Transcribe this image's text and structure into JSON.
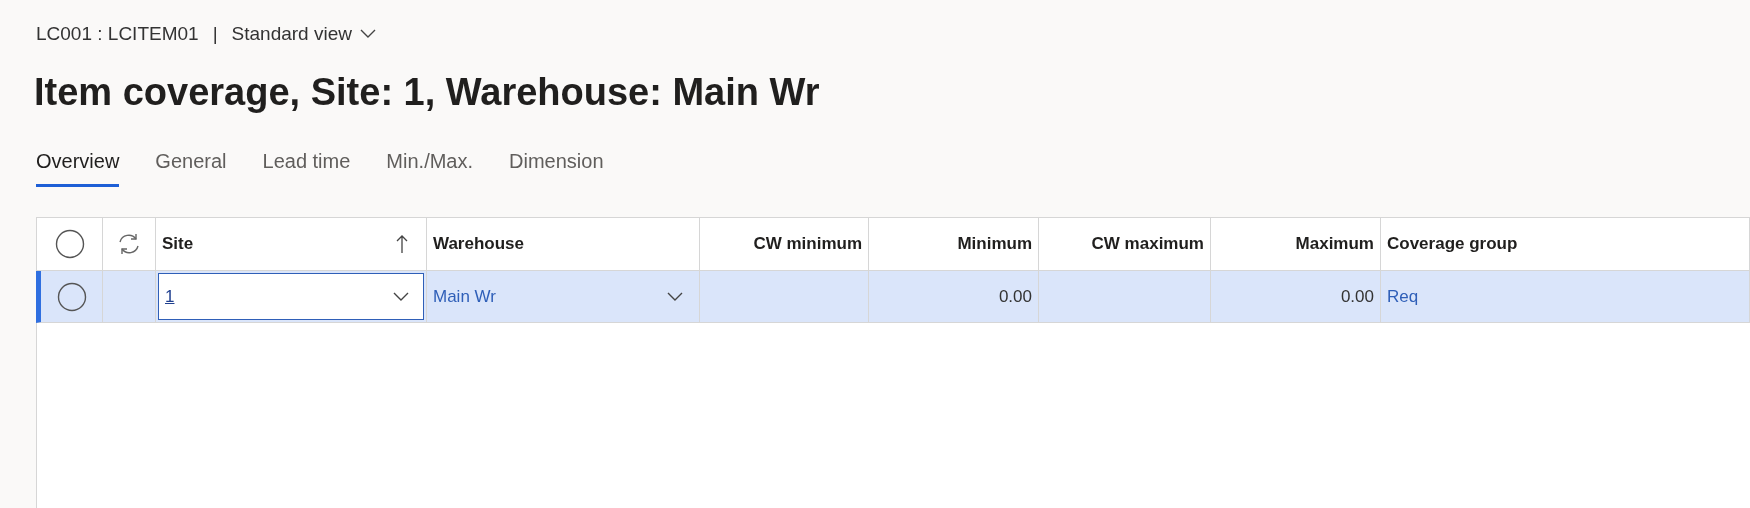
{
  "breadcrumb": {
    "record": "LC001 : LCITEM01",
    "separator": "|",
    "view": "Standard view"
  },
  "title": "Item coverage, Site: 1, Warehouse: Main Wr",
  "tabs": [
    {
      "label": "Overview",
      "selected": true
    },
    {
      "label": "General",
      "selected": false
    },
    {
      "label": "Lead time",
      "selected": false
    },
    {
      "label": "Min./Max.",
      "selected": false
    },
    {
      "label": "Dimension",
      "selected": false
    }
  ],
  "grid": {
    "columns": [
      {
        "label": "Site",
        "kind": "text",
        "sorted": true
      },
      {
        "label": "Warehouse",
        "kind": "text",
        "sorted": false
      },
      {
        "label": "CW minimum",
        "kind": "number",
        "sorted": false
      },
      {
        "label": "Minimum",
        "kind": "number",
        "sorted": false
      },
      {
        "label": "CW maximum",
        "kind": "number",
        "sorted": false
      },
      {
        "label": "Maximum",
        "kind": "number",
        "sorted": false
      },
      {
        "label": "Coverage group",
        "kind": "text",
        "sorted": false
      }
    ],
    "rows": [
      {
        "selected": true,
        "cells": [
          {
            "kind": "edit-dropdown",
            "value": "1"
          },
          {
            "kind": "link-dropdown",
            "value": "Main Wr"
          },
          {
            "kind": "number"
          },
          {
            "kind": "number",
            "value": "0.00"
          },
          {
            "kind": "number"
          },
          {
            "kind": "number",
            "value": "0.00"
          },
          {
            "kind": "link",
            "value": "Req"
          }
        ]
      }
    ]
  }
}
